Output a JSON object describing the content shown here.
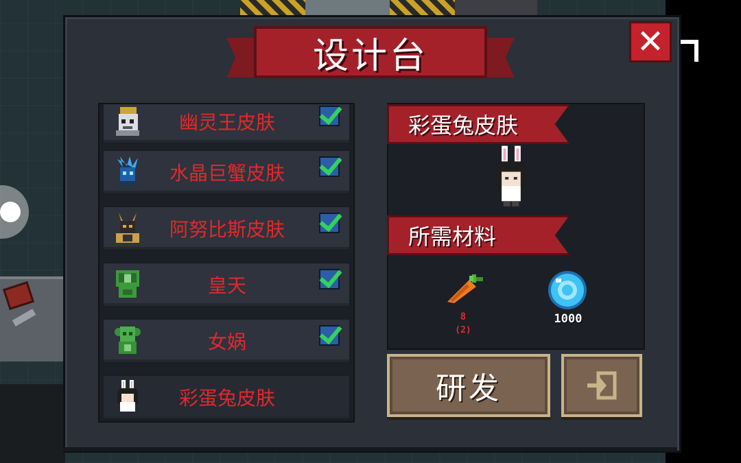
{
  "title": "设计台",
  "skins": [
    {
      "name": "幽灵王皮肤",
      "owned": true,
      "icon": "ghost-king-icon"
    },
    {
      "name": "水晶巨蟹皮肤",
      "owned": true,
      "icon": "crystal-crab-icon"
    },
    {
      "name": "阿努比斯皮肤",
      "owned": true,
      "icon": "anubis-icon"
    },
    {
      "name": "皇天",
      "owned": true,
      "icon": "huangtian-icon"
    },
    {
      "name": "女娲",
      "owned": true,
      "icon": "nuwa-icon"
    },
    {
      "name": "彩蛋兔皮肤",
      "owned": false,
      "icon": "easter-bunny-icon"
    }
  ],
  "detail": {
    "skin_name": "彩蛋兔皮肤",
    "materials_title": "所需材料",
    "materials": [
      {
        "icon": "carrot-icon",
        "amount": "8",
        "owned": "(2)",
        "color": "#e0292c"
      },
      {
        "icon": "gem-icon",
        "amount": "1000",
        "color": "#ffffff"
      }
    ]
  },
  "buttons": {
    "research": "研发"
  },
  "colors": {
    "banner": "#a5212a",
    "skin_text": "#e0292c",
    "check": "#35d05f"
  }
}
